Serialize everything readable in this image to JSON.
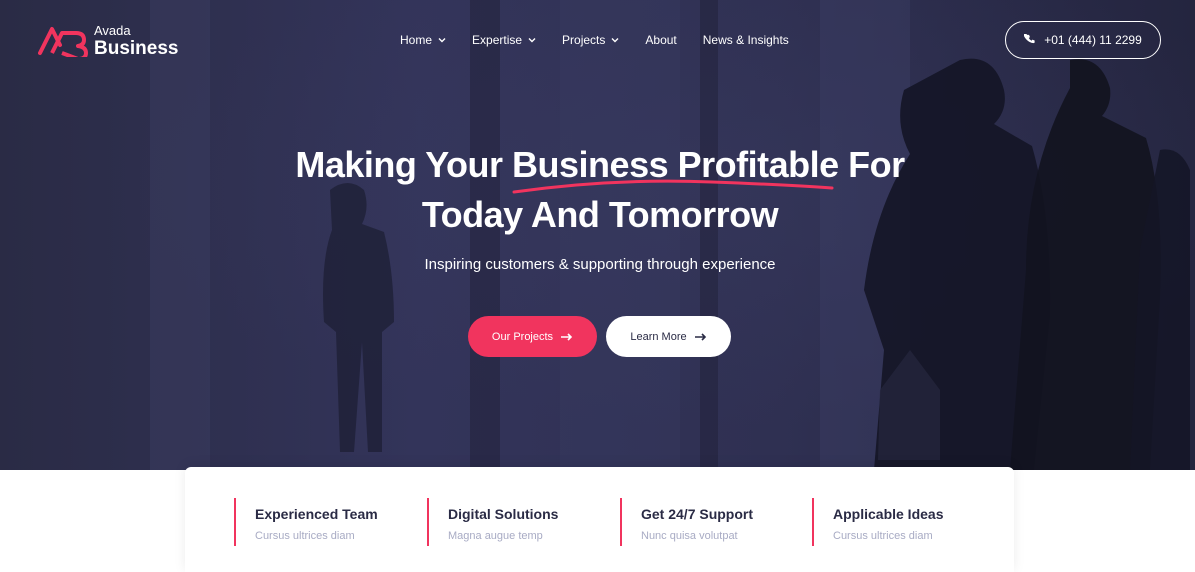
{
  "brand": {
    "small": "Avada",
    "big": "Business",
    "accent": "#f1345e"
  },
  "nav": {
    "items": [
      {
        "label": "Home",
        "has_dropdown": true
      },
      {
        "label": "Expertise",
        "has_dropdown": true
      },
      {
        "label": "Projects",
        "has_dropdown": true
      },
      {
        "label": "About",
        "has_dropdown": false
      },
      {
        "label": "News & Insights",
        "has_dropdown": false
      }
    ]
  },
  "header": {
    "phone": "+01 (444) 11 2299",
    "phone_icon": "phone-icon"
  },
  "hero": {
    "headline_line1": "Making Your Business Profitable For",
    "headline_line2": "Today And Tomorrow",
    "subtitle": "Inspiring customers & supporting through experience",
    "primary_button": "Our Projects",
    "secondary_button": "Learn More",
    "button_icon": "arrow-right-icon"
  },
  "features": [
    {
      "title": "Experienced Team",
      "desc": "Cursus ultrices diam"
    },
    {
      "title": "Digital Solutions",
      "desc": "Magna augue temp"
    },
    {
      "title": "Get 24/7 Support",
      "desc": "Nunc quisa volutpat"
    },
    {
      "title": "Applicable Ideas",
      "desc": "Cursus ultrices diam"
    }
  ]
}
